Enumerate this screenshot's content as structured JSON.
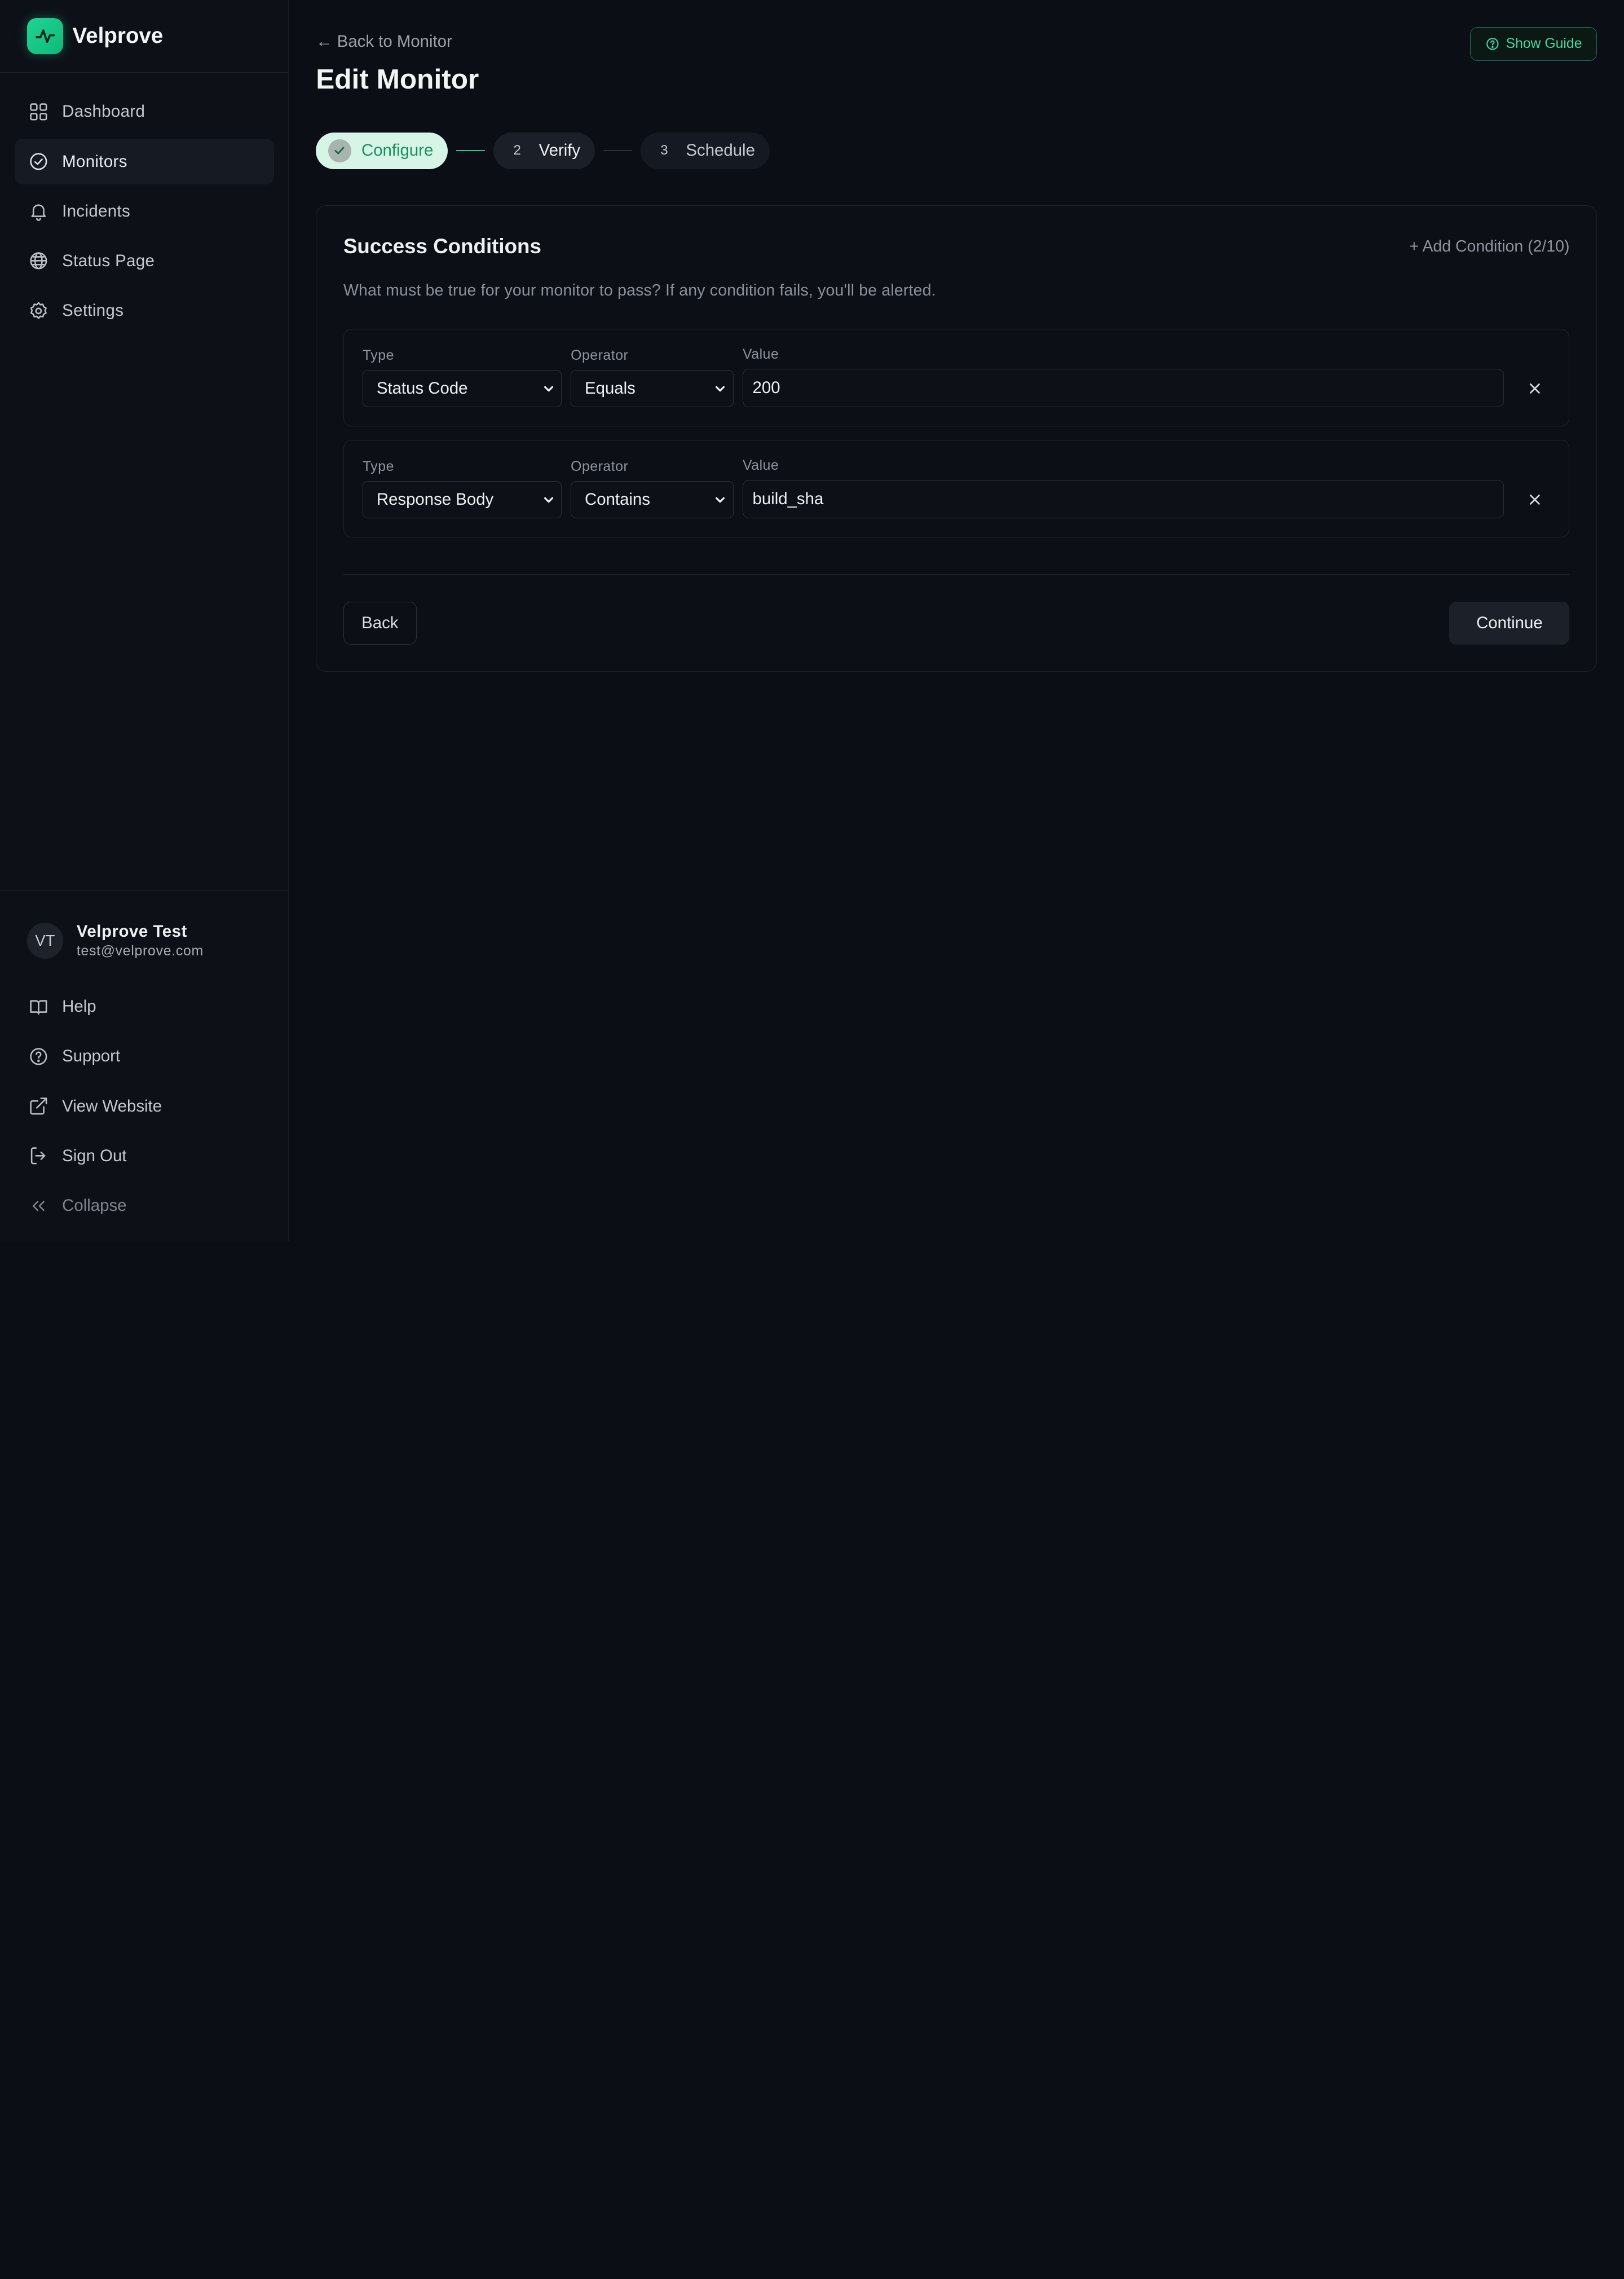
{
  "brand": {
    "name": "Velprove",
    "logo_icon": "activity-pulse-icon",
    "accent": "#20d494"
  },
  "sidebar": {
    "items": [
      {
        "label": "Dashboard",
        "icon": "grid-icon"
      },
      {
        "label": "Monitors",
        "icon": "check-circle-icon",
        "active": true
      },
      {
        "label": "Incidents",
        "icon": "bell-icon"
      },
      {
        "label": "Status Page",
        "icon": "globe-icon"
      },
      {
        "label": "Settings",
        "icon": "gear-icon"
      }
    ],
    "user": {
      "initials": "VT",
      "name": "Velprove Test",
      "email": "test@velprove.com"
    },
    "footer": [
      {
        "label": "Help",
        "icon": "book-icon"
      },
      {
        "label": "Support",
        "icon": "help-circle-icon"
      },
      {
        "label": "View Website",
        "icon": "external-link-icon"
      },
      {
        "label": "Sign Out",
        "icon": "sign-out-icon"
      },
      {
        "label": "Collapse",
        "icon": "chevrons-left-icon"
      }
    ]
  },
  "header": {
    "back_link": "← Back to Monitor",
    "title": "Edit Monitor",
    "guide_button": "Show Guide"
  },
  "stepper": {
    "steps": [
      {
        "number": "1",
        "label": "Configure",
        "state": "done"
      },
      {
        "number": "2",
        "label": "Verify",
        "state": "current"
      },
      {
        "number": "3",
        "label": "Schedule",
        "state": "future"
      }
    ]
  },
  "conditions": {
    "title": "Success Conditions",
    "add_label": "+ Add Condition (2/10)",
    "description": "What must be true for your monitor to pass? If any condition fails, you'll be alerted.",
    "labels": {
      "type": "Type",
      "operator": "Operator",
      "value": "Value"
    },
    "rows": [
      {
        "type": "Status Code",
        "operator": "Equals",
        "value": "200"
      },
      {
        "type": "Response Body",
        "operator": "Contains",
        "value": "build_sha"
      }
    ]
  },
  "actions": {
    "back": "Back",
    "continue": "Continue"
  }
}
